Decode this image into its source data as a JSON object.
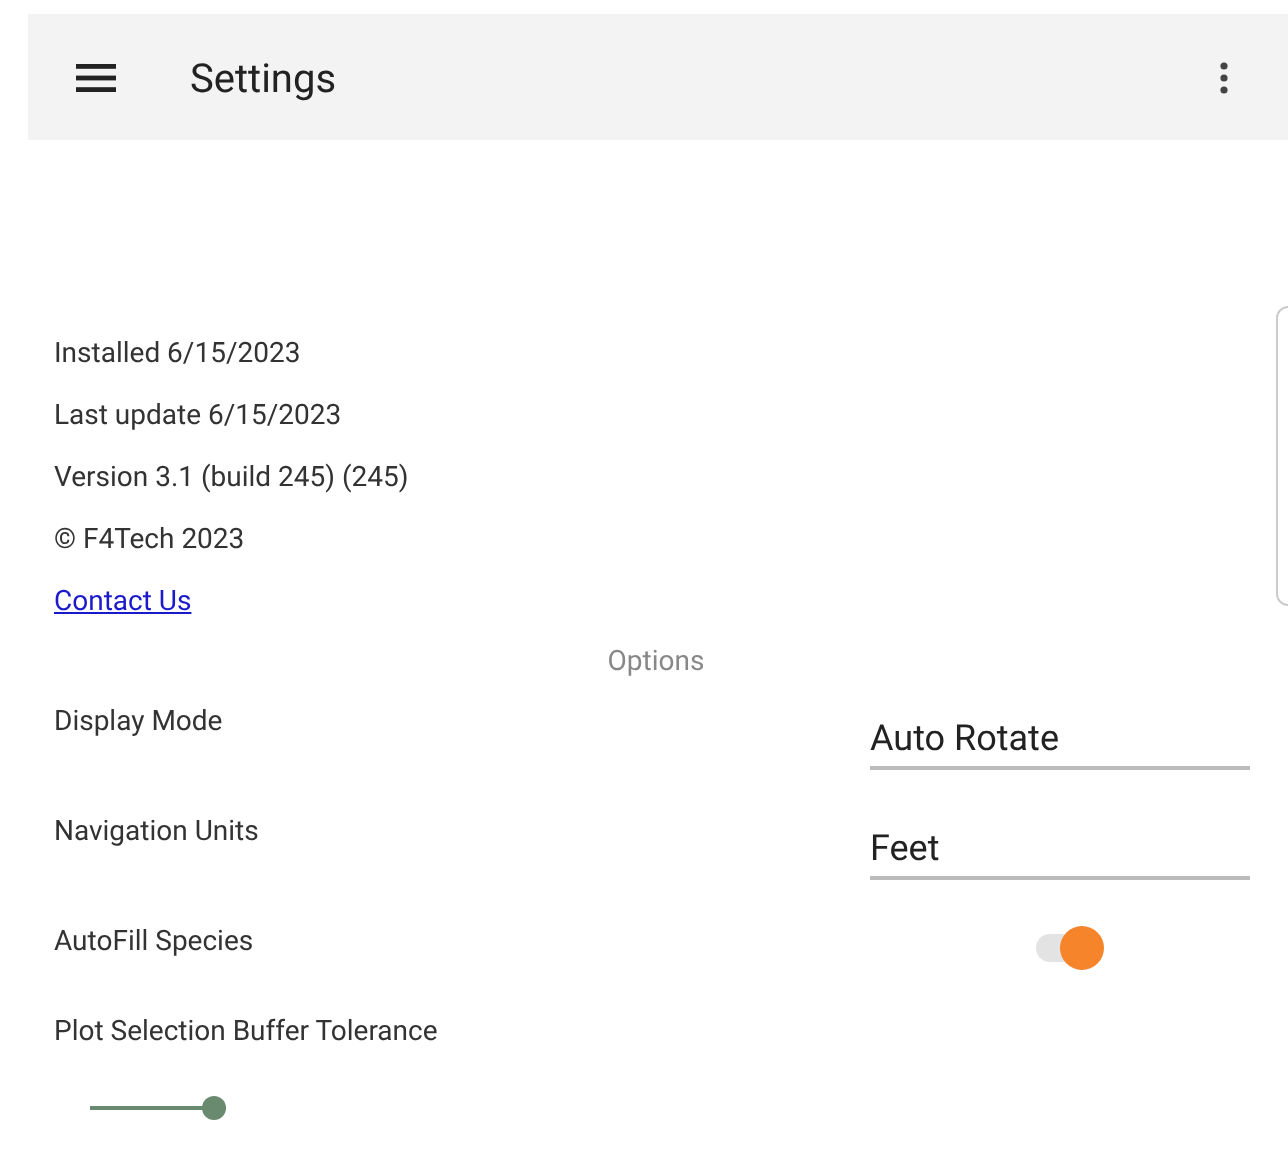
{
  "app_bar": {
    "title": "Settings"
  },
  "info": [
    {
      "text": "Installed 6/15/2023",
      "kind": "text"
    },
    {
      "text": "Last update 6/15/2023",
      "kind": "text"
    },
    {
      "text": "Version 3.1 (build 245) (245)",
      "kind": "text"
    },
    {
      "text": "© F4Tech 2023",
      "kind": "text"
    },
    {
      "text": "Contact Us",
      "kind": "link"
    }
  ],
  "section_title": "Options",
  "settings": [
    {
      "label": "Display Mode",
      "kind": "select",
      "value": "Auto Rotate"
    },
    {
      "label": "Navigation Units",
      "kind": "select",
      "value": "Feet"
    },
    {
      "label": "AutoFill Species",
      "kind": "switch",
      "on": true
    },
    {
      "label": "Plot Selection Buffer Tolerance",
      "kind": "slider",
      "level": 1
    }
  ]
}
